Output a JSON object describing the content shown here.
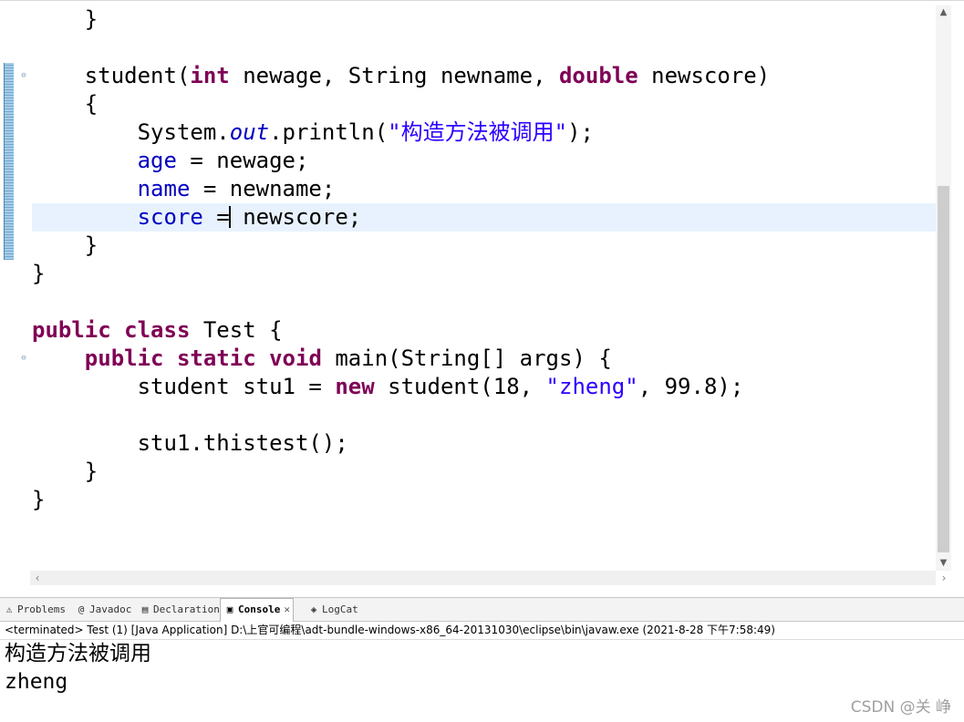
{
  "editor": {
    "lines": [
      {
        "segments": [
          {
            "t": "    }",
            "c": ""
          }
        ]
      },
      {
        "segments": [
          {
            "t": "",
            "c": ""
          }
        ]
      },
      {
        "fold": true,
        "segments": [
          {
            "t": "    student(",
            "c": ""
          },
          {
            "t": "int",
            "c": "kw"
          },
          {
            "t": " newage, String newname, ",
            "c": ""
          },
          {
            "t": "double",
            "c": "kw"
          },
          {
            "t": " newscore)",
            "c": ""
          }
        ]
      },
      {
        "segments": [
          {
            "t": "    {",
            "c": ""
          }
        ]
      },
      {
        "segments": [
          {
            "t": "        System.",
            "c": ""
          },
          {
            "t": "out",
            "c": "sfld"
          },
          {
            "t": ".println(",
            "c": ""
          },
          {
            "t": "\"构造方法被调用\"",
            "c": "str"
          },
          {
            "t": ");",
            "c": ""
          }
        ]
      },
      {
        "segments": [
          {
            "t": "        ",
            "c": ""
          },
          {
            "t": "age",
            "c": "fld"
          },
          {
            "t": " = newage;",
            "c": ""
          }
        ]
      },
      {
        "segments": [
          {
            "t": "        ",
            "c": ""
          },
          {
            "t": "name",
            "c": "fld"
          },
          {
            "t": " = newname;",
            "c": ""
          }
        ]
      },
      {
        "current": true,
        "segments": [
          {
            "t": "        ",
            "c": ""
          },
          {
            "t": "score",
            "c": "fld"
          },
          {
            "t": " =",
            "c": ""
          },
          {
            "t": "",
            "c": "caret"
          },
          {
            "t": " newscore;",
            "c": ""
          }
        ]
      },
      {
        "segments": [
          {
            "t": "    }",
            "c": ""
          }
        ]
      },
      {
        "segments": [
          {
            "t": "}",
            "c": ""
          }
        ]
      },
      {
        "segments": [
          {
            "t": "",
            "c": ""
          }
        ]
      },
      {
        "segments": [
          {
            "t": "public",
            "c": "kw"
          },
          {
            "t": " ",
            "c": ""
          },
          {
            "t": "class",
            "c": "kw"
          },
          {
            "t": " Test {",
            "c": ""
          }
        ]
      },
      {
        "fold": true,
        "segments": [
          {
            "t": "    ",
            "c": ""
          },
          {
            "t": "public",
            "c": "kw"
          },
          {
            "t": " ",
            "c": ""
          },
          {
            "t": "static",
            "c": "kw"
          },
          {
            "t": " ",
            "c": ""
          },
          {
            "t": "void",
            "c": "kw"
          },
          {
            "t": " main(String[] args) {",
            "c": ""
          }
        ]
      },
      {
        "segments": [
          {
            "t": "        student stu1 = ",
            "c": ""
          },
          {
            "t": "new",
            "c": "kw"
          },
          {
            "t": " student(18, ",
            "c": ""
          },
          {
            "t": "\"zheng\"",
            "c": "str"
          },
          {
            "t": ", 99.8);",
            "c": ""
          }
        ]
      },
      {
        "segments": [
          {
            "t": "",
            "c": ""
          }
        ]
      },
      {
        "segments": [
          {
            "t": "        stu1.thistest();",
            "c": ""
          }
        ]
      },
      {
        "segments": [
          {
            "t": "    }",
            "c": ""
          }
        ]
      },
      {
        "segments": [
          {
            "t": "}",
            "c": ""
          }
        ]
      }
    ]
  },
  "tabs": [
    {
      "label": "Problems",
      "icon": "problems-icon",
      "glyph": "⚠",
      "active": false
    },
    {
      "label": "Javadoc",
      "icon": "javadoc-icon",
      "glyph": "@",
      "active": false
    },
    {
      "label": "Declaration",
      "icon": "declaration-icon",
      "glyph": "▤",
      "active": false
    },
    {
      "label": "Console",
      "icon": "console-icon",
      "glyph": "▣",
      "active": true
    },
    {
      "label": "LogCat",
      "icon": "logcat-icon",
      "glyph": "◈",
      "active": false
    }
  ],
  "console": {
    "header": "<terminated> Test (1) [Java Application] D:\\上官可编程\\adt-bundle-windows-x86_64-20131030\\eclipse\\bin\\javaw.exe (2021-8-28 下午7:58:49)",
    "output": [
      "构造方法被调用",
      "zheng"
    ]
  },
  "watermark": "CSDN @关 峥",
  "colors": {
    "keyword": "#7f0055",
    "field": "#0000c0",
    "string": "#2a00ff",
    "current_line": "#e8f2fe"
  }
}
